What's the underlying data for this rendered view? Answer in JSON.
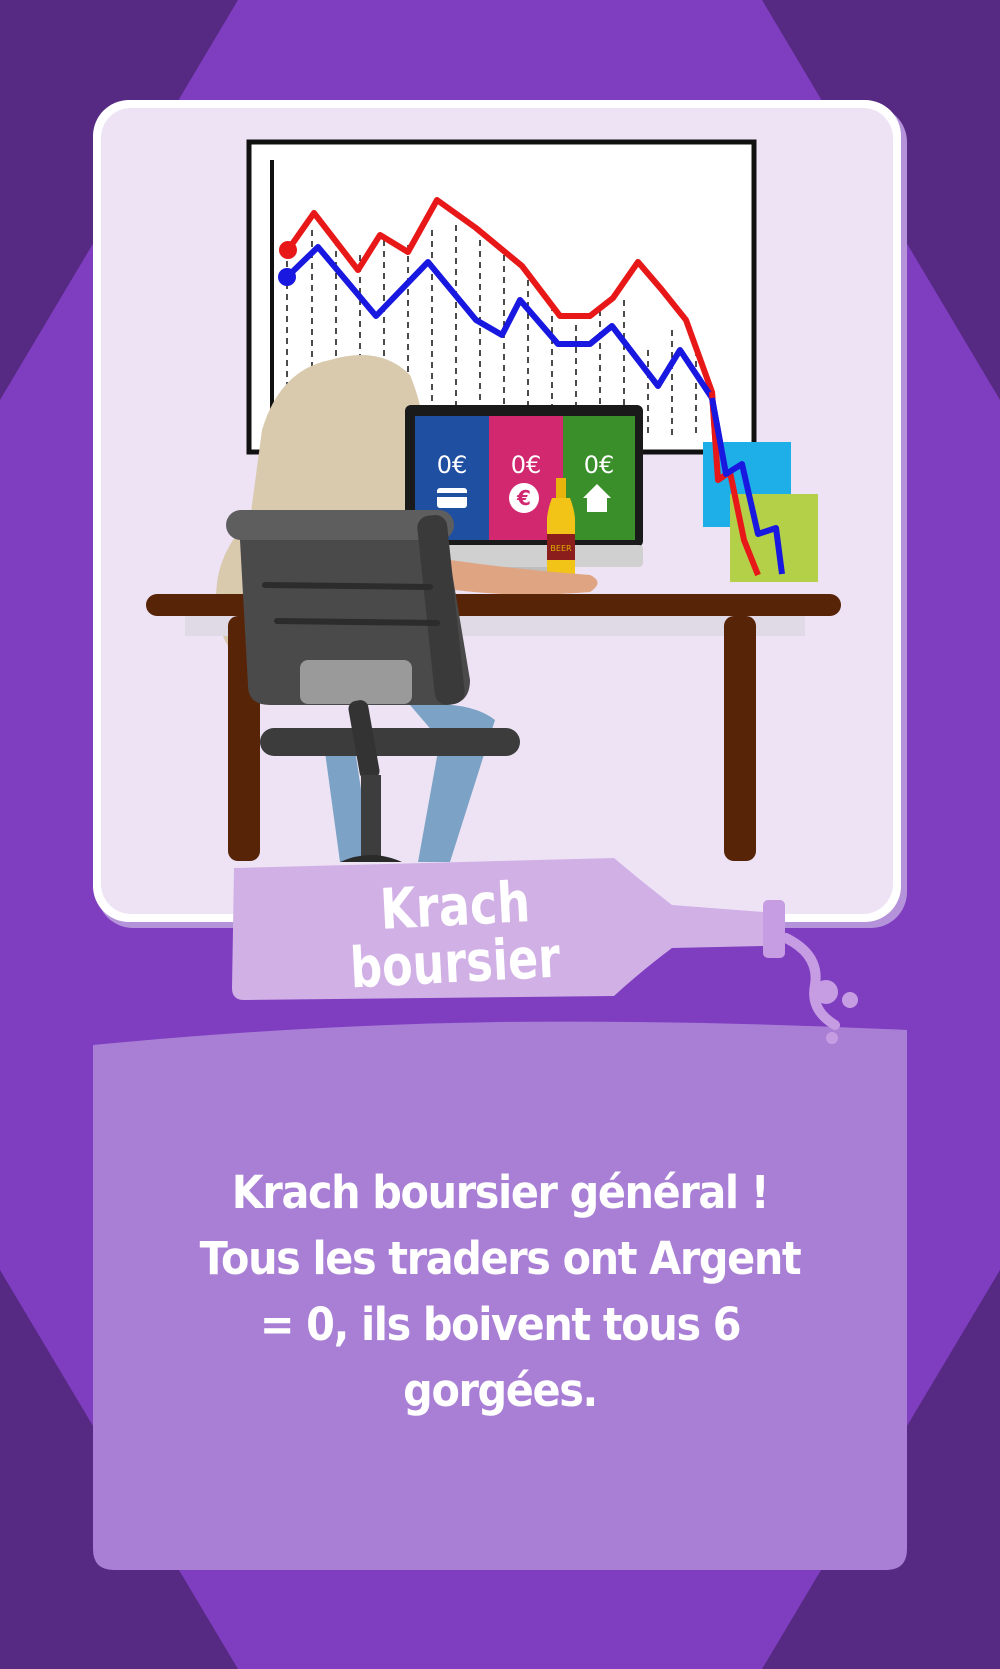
{
  "card": {
    "title_line1": "Krach",
    "title_line2": "boursier",
    "description": "Krach boursier général ! Tous les traders ont Argent = 0, ils boivent tous 6 gorgées."
  },
  "monitor": {
    "tiles": [
      {
        "value": "0€",
        "icon": "credit-card-icon",
        "color": "#1f4fa0"
      },
      {
        "value": "0€",
        "icon": "euro-coin-icon",
        "color": "#d2286f"
      },
      {
        "value": "0€",
        "icon": "house-icon",
        "color": "#3a8f2a"
      }
    ]
  },
  "bottle_label": "BEER",
  "colors": {
    "background": "#562a83",
    "octagon": "#7f3dc0",
    "card_panel": "#a97fd6",
    "art_panel": "#ede3f5",
    "line_red": "#e81818",
    "line_blue": "#1818e0"
  }
}
